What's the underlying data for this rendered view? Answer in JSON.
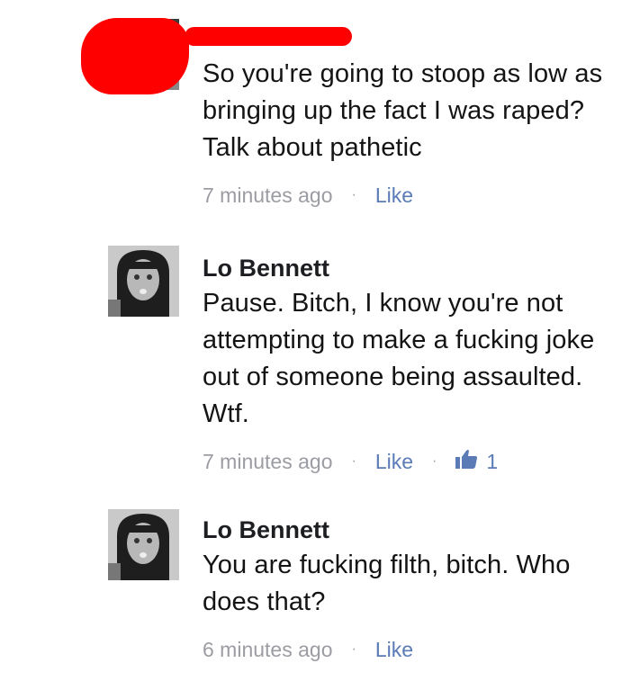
{
  "comments": [
    {
      "author": "",
      "text": "So you're going to stoop as low as bringing up the fact I was raped? Talk about pathetic",
      "time": "7 minutes ago",
      "like_label": "Like",
      "like_count": null,
      "redacted": true
    },
    {
      "author": "Lo Bennett",
      "text": "Pause. Bitch, I know you're not attempting to make a fucking joke out of someone being assaulted. Wtf.",
      "time": "7 minutes ago",
      "like_label": "Like",
      "like_count": "1",
      "redacted": false
    },
    {
      "author": "Lo Bennett",
      "text": "You are fucking filth, bitch. Who does that?",
      "time": "6 minutes ago",
      "like_label": "Like",
      "like_count": null,
      "redacted": false
    }
  ],
  "separator": "·",
  "icons": {
    "like_count_icon": "thumbs-up-icon"
  },
  "colors": {
    "link": "#5b7bb7",
    "meta": "#9b9da3",
    "redaction": "#ff0000"
  }
}
